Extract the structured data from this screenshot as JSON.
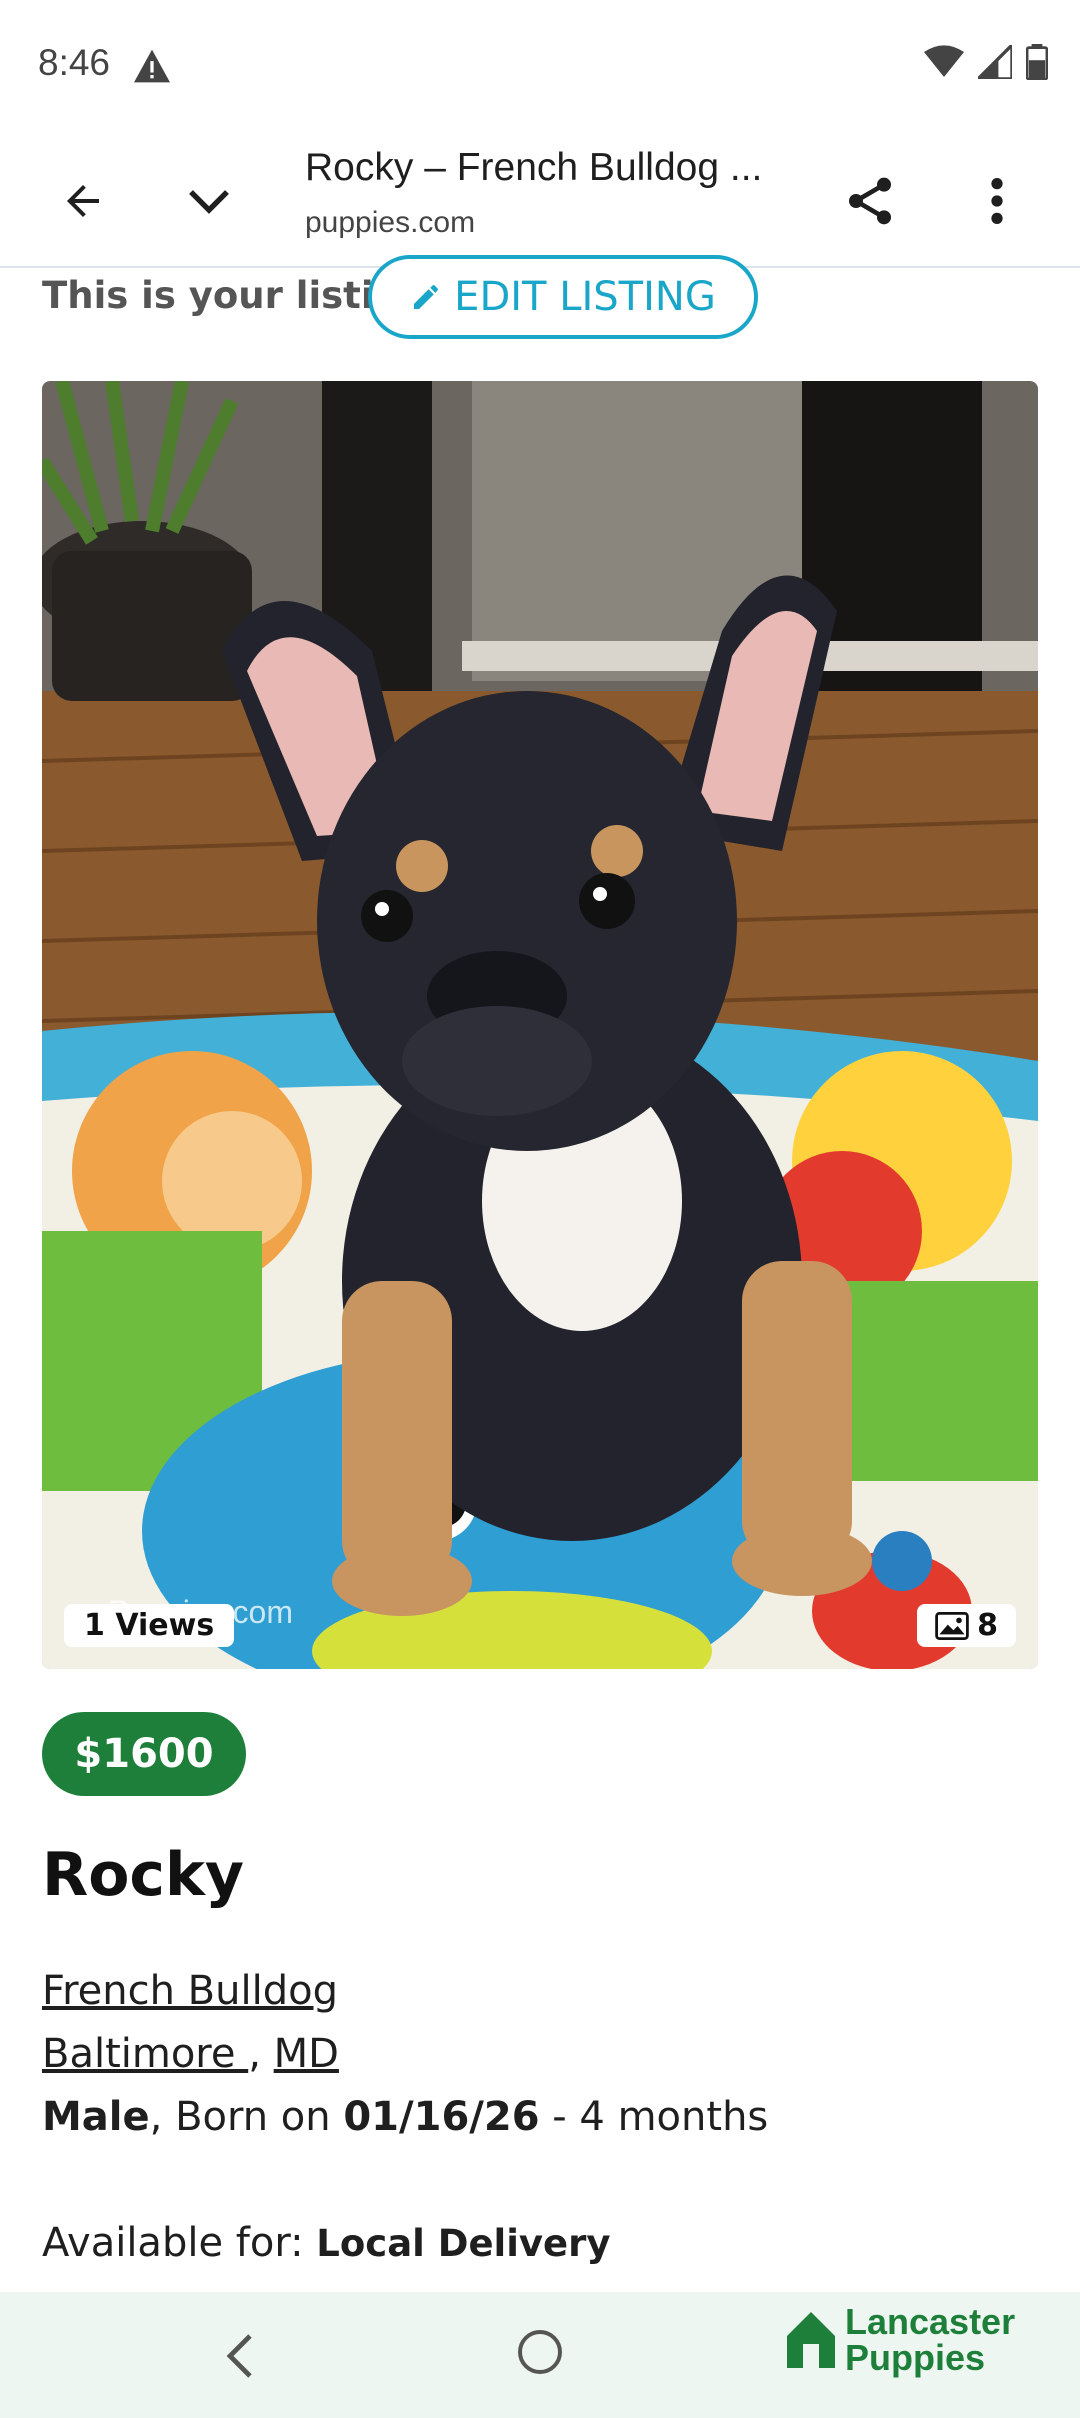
{
  "status_bar": {
    "time": "8:46"
  },
  "browser": {
    "title": "Rocky – French Bulldog ...",
    "url": "puppies.com"
  },
  "listing": {
    "notice": "This is your listing",
    "edit_label": "EDIT LISTING",
    "views": "1 Views",
    "photo_count": "8",
    "watermark": "Puppies.com",
    "price": "$1600",
    "name": "Rocky",
    "breed": "French Bulldog",
    "city": "Baltimore ",
    "comma": ",",
    "state": "MD",
    "sex": "Male",
    "born_prefix": ", Born on ",
    "born_date": "01/16/26",
    "age_suffix": " - 4 months",
    "available_prefix": "Available for: ",
    "available_value": "Local Delivery"
  },
  "brand": {
    "line1": "Lancaster",
    "line2": "Puppies"
  },
  "colors": {
    "accent": "#19a6c8",
    "price_green": "#1e7f3a"
  }
}
